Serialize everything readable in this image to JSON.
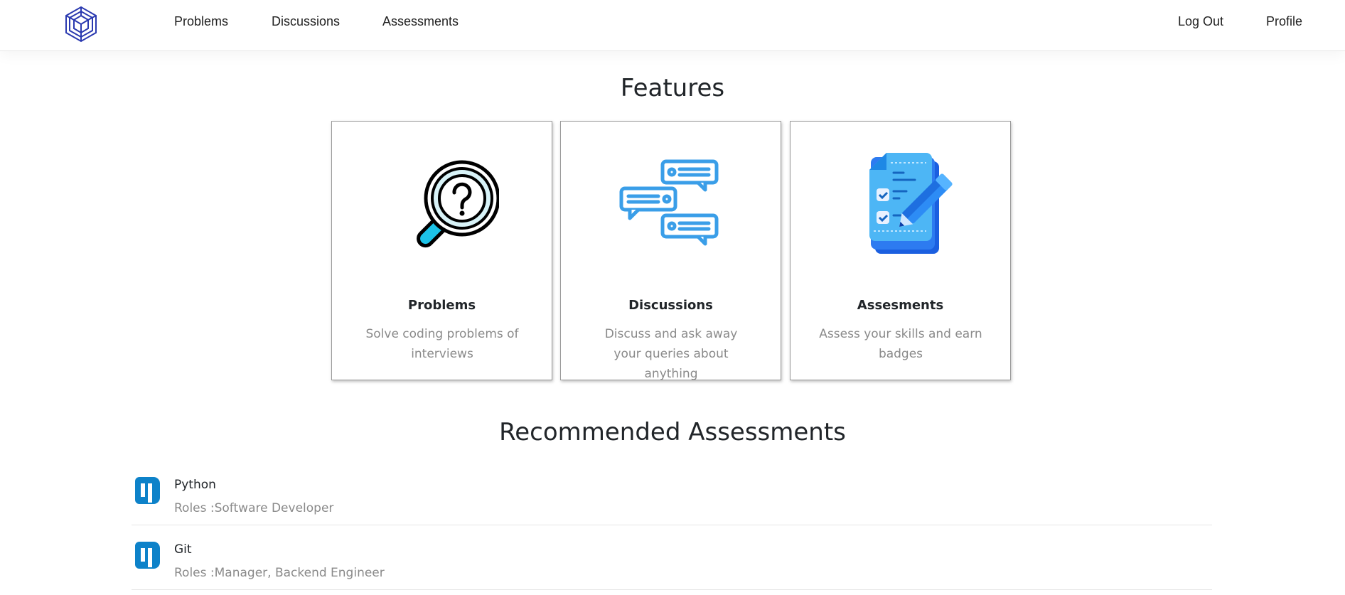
{
  "nav": {
    "links": [
      "Problems",
      "Discussions",
      "Assessments"
    ],
    "right_links": [
      "Log Out",
      "Profile"
    ],
    "logo_icon": "cube-hexagon-logo-icon",
    "logo_color": "#2b3ab0"
  },
  "features": {
    "title": "Features",
    "cards": [
      {
        "title": "Problems",
        "desc": "Solve coding problems of interviews",
        "icon": "magnifier-question-icon"
      },
      {
        "title": "Discussions",
        "desc": "Discuss and ask away your queries about anything",
        "icon": "chat-bubbles-icon"
      },
      {
        "title": "Assesments",
        "desc": "Assess your skills and earn badges",
        "icon": "checklist-pencil-icon"
      }
    ]
  },
  "recommended": {
    "title": "Recommended Assessments",
    "items": [
      {
        "name": "Python",
        "roles": "Roles :Software Developer",
        "icon": "assessment-logo-icon"
      },
      {
        "name": "Git",
        "roles": "Roles :Manager, Backend Engineer",
        "icon": "assessment-logo-icon"
      }
    ]
  },
  "colors": {
    "accent_blue": "#1e88e5",
    "logo_blue": "#0d82c9",
    "text_muted": "#8a8a8a"
  }
}
